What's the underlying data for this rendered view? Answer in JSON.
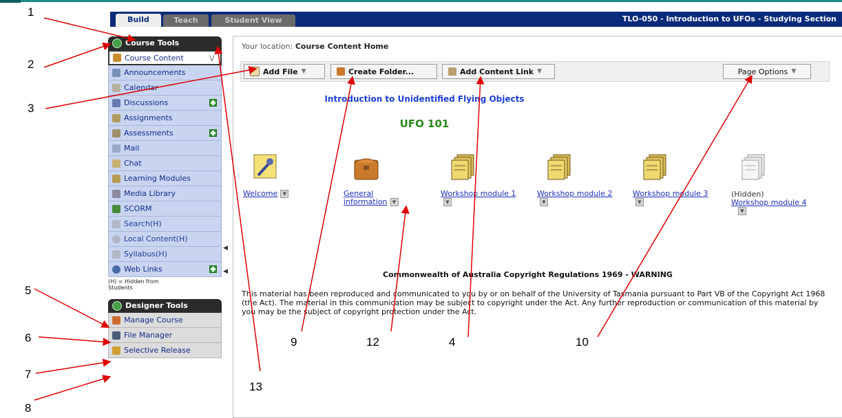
{
  "tabs": [
    "Build",
    "Teach",
    "Student View"
  ],
  "course_title": "TLO-050 - Introduction to UFOs - Studying Section",
  "sidebar": {
    "course_tools_title": "Course Tools",
    "items": [
      {
        "label": "Course Content",
        "icon": "folder-icon"
      },
      {
        "label": "Announcements",
        "icon": "announcement-icon"
      },
      {
        "label": "Calendar",
        "icon": "calendar-icon"
      },
      {
        "label": "Discussions",
        "icon": "pushpin-icon"
      },
      {
        "label": "Assignments",
        "icon": "assignment-icon"
      },
      {
        "label": "Assessments",
        "icon": "assessment-icon"
      },
      {
        "label": "Mail",
        "icon": "mail-icon"
      },
      {
        "label": "Chat",
        "icon": "chat-icon"
      },
      {
        "label": "Learning Modules",
        "icon": "module-icon"
      },
      {
        "label": "Media Library",
        "icon": "media-icon"
      },
      {
        "label": "SCORM",
        "icon": "scorm-icon"
      },
      {
        "label": "Search(H)",
        "icon": "search-icon"
      },
      {
        "label": "Local Content(H)",
        "icon": "local-content-icon"
      },
      {
        "label": "Syllabus(H)",
        "icon": "syllabus-icon"
      },
      {
        "label": "Web Links",
        "icon": "web-links-icon"
      }
    ],
    "hidden_note": "(H) = Hidden from Students",
    "designer_tools_title": "Designer Tools",
    "designer_items": [
      {
        "label": "Manage Course",
        "icon": "manage-course-icon"
      },
      {
        "label": "File Manager",
        "icon": "file-manager-icon"
      },
      {
        "label": "Selective Release",
        "icon": "selective-release-icon"
      }
    ]
  },
  "main": {
    "location_label": "Your location:",
    "location_value": "Course Content Home",
    "toolbar": {
      "add_file": "Add File",
      "create_folder": "Create Folder...",
      "add_content_link": "Add Content Link",
      "page_options": "Page Options"
    },
    "course_name": "Introduction to Unidentified Flying Objects",
    "course_code": "UFO 101",
    "items": [
      {
        "label": "Welcome",
        "icon": "pushpin-icon"
      },
      {
        "label": "General information",
        "icon": "folder-icon"
      },
      {
        "label": "Workshop module 1",
        "icon": "module-icon"
      },
      {
        "label": "Workshop module 2",
        "icon": "module-icon"
      },
      {
        "label": "Workshop module 3",
        "icon": "module-icon"
      },
      {
        "label": "Workshop module 4",
        "icon": "module-icon",
        "hidden_tag": "(Hidden)"
      }
    ],
    "warning_title": "Commonwealth of Australia Copyright Regulations 1969 - WARNING",
    "warning_text": "This material has been reproduced and communicated to you by or on behalf of the University of Tasmania pursuant to Part VB of the Copyright Act 1968 (the Act). The material in this communication may be subject to copyright under the Act. Any further reproduction or communication of this material by you may be the subject of copyright protection under the Act."
  },
  "callouts": [
    "1",
    "2",
    "3",
    "4",
    "5",
    "6",
    "7",
    "8",
    "9",
    "10",
    "12",
    "13"
  ],
  "colors": {
    "tab_bar": "#0a2a7a",
    "sidebar_item": "#c9d5f0",
    "link": "#1d30b8",
    "course_code": "#2a8a1c",
    "arrow": "#e00000"
  }
}
